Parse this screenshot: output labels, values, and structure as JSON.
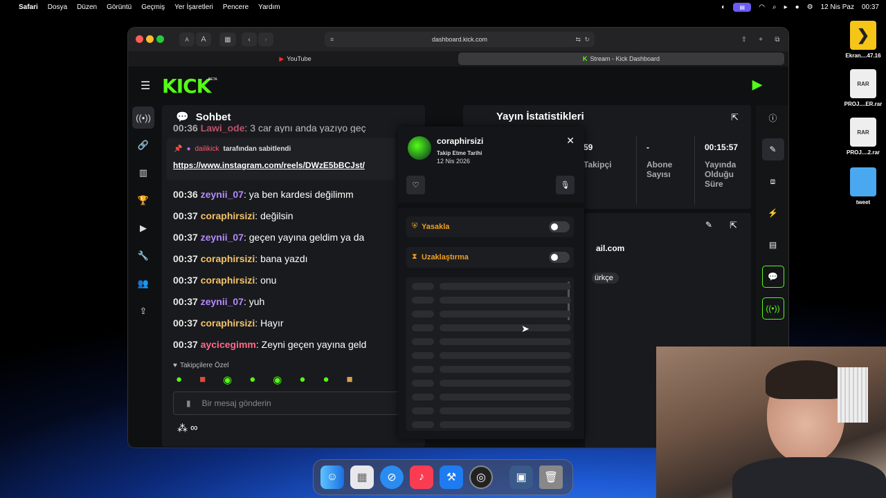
{
  "menubar": {
    "apple": "",
    "app": "Safari",
    "items": [
      "Dosya",
      "Düzen",
      "Görüntü",
      "Geçmiş",
      "Yer İşaretleri",
      "Pencere",
      "Yardım"
    ],
    "date": "12 Nis Paz",
    "time": "00:37"
  },
  "desktop": {
    "icons": [
      {
        "label": "Ekran....47.16"
      },
      {
        "label": "PROJ....ER.rar",
        "badge": "RAR"
      },
      {
        "label": "PROJ....2.rar",
        "badge": "RAR"
      },
      {
        "label": "tweet"
      }
    ]
  },
  "browser": {
    "url": "dashboard.kick.com",
    "text_size_small": "A",
    "text_size_large": "A",
    "tabs": [
      {
        "label": "YouTube"
      },
      {
        "label": "Stream - Kick Dashboard"
      }
    ]
  },
  "kick": {
    "logo": "KICK",
    "logo_badge": "BETA"
  },
  "chat": {
    "title": "Sohbet",
    "partial_top": "00:36 ",
    "partial_user": "Lawi_ode",
    "partial_text": ": 3 car aynı anda yazıyo geç",
    "pinned": {
      "by_user": "dailikick",
      "by_suffix": "tarafından sabitlendi",
      "link": "https://www.instagram.com/reels/DWzE5bBCJst/"
    },
    "messages": [
      {
        "time": "00:36",
        "user": "zeynii_07",
        "color": "u1",
        "text": ": ya ben kardesi değilimm"
      },
      {
        "time": "00:37",
        "user": "coraphirsizi",
        "color": "u2",
        "text": ": değilsin"
      },
      {
        "time": "00:37",
        "user": "zeynii_07",
        "color": "u1",
        "text": ": geçen yayına geldim ya da"
      },
      {
        "time": "00:37",
        "user": "coraphirsizi",
        "color": "u2",
        "text": ": bana yazdı"
      },
      {
        "time": "00:37",
        "user": "coraphirsizi",
        "color": "u2",
        "text": ": onu"
      },
      {
        "time": "00:37",
        "user": "zeynii_07",
        "color": "u1",
        "text": ": yuh"
      },
      {
        "time": "00:37",
        "user": "coraphirsizi",
        "color": "u2",
        "text": ": Hayır"
      },
      {
        "time": "00:37",
        "user": "aycicegimm",
        "color": "u3",
        "text": ": Zeyni geçen yayına geld"
      }
    ],
    "emote_label": "Takipçilere Özel",
    "input_placeholder": "Bir mesaj gönderin",
    "infinity": "∞"
  },
  "stats": {
    "title": "Yayın İstatistikleri",
    "cols": [
      {
        "value": "59",
        "label": "Takipçi"
      },
      {
        "value": "-",
        "label": "Abone Sayısı"
      },
      {
        "value": "00:15:57",
        "label": "Yayında Olduğu Süre"
      }
    ]
  },
  "info": {
    "email_partial": "ail.com",
    "lang_partial": "ürkçe"
  },
  "popup": {
    "username": "coraphirsizi",
    "follow_label": "Takip Etme Tarihi",
    "follow_date": "12 Nis 2026",
    "ban_label": "Yasakla",
    "timeout_label": "Uzaklaştırma",
    "ban_on": false,
    "timeout_on": false
  },
  "colors": {
    "kick_green": "#53fc18",
    "ban": "#f0a020",
    "timeout": "#f0a020"
  }
}
